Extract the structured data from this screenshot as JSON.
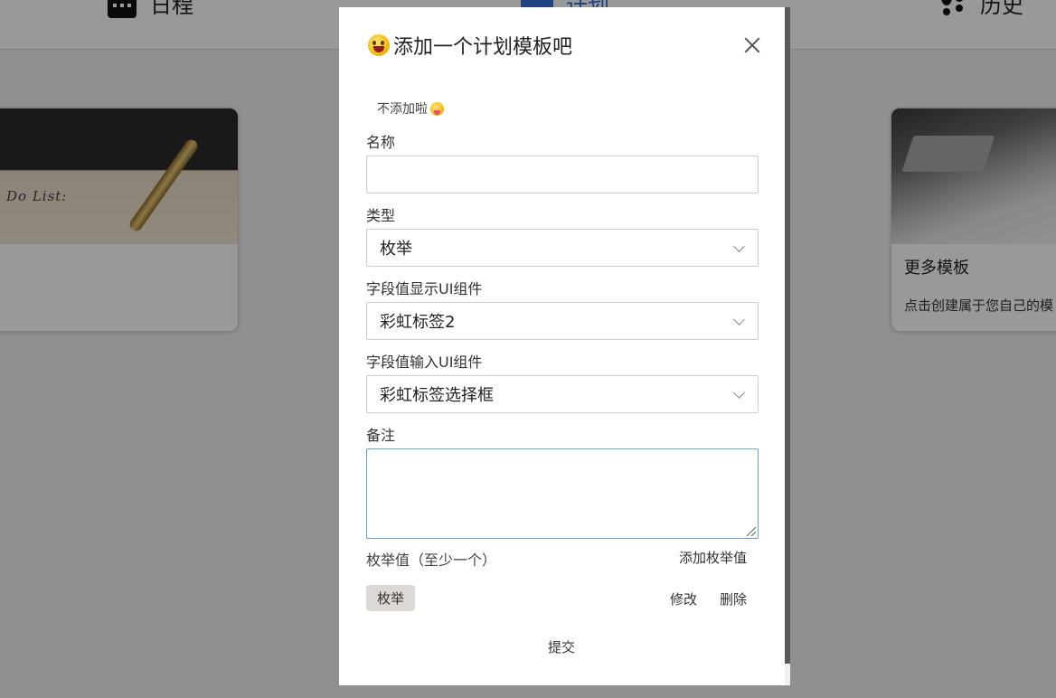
{
  "nav": {
    "schedule_label": "日程",
    "plan_label": "计划",
    "history_label": "历史"
  },
  "cards": {
    "left": {
      "photo_text": "Do List:"
    },
    "right": {
      "title": "更多模板",
      "desc": "点击创建属于您自己的模"
    }
  },
  "modal": {
    "title": "添加一个计划模板吧",
    "skip_label": "不添加啦",
    "fields": {
      "name_label": "名称",
      "name_value": "",
      "type_label": "类型",
      "type_value": "枚举",
      "display_label": "字段值显示UI组件",
      "display_value": "彩虹标签2",
      "input_label": "字段值输入UI组件",
      "input_value": "彩虹标签选择框",
      "note_label": "备注",
      "note_value": ""
    },
    "enum": {
      "label": "枚举值（至少一个）",
      "add_label": "添加枚举值",
      "items": [
        {
          "value": "枚举",
          "edit_label": "修改",
          "delete_label": "删除"
        }
      ]
    },
    "submit_label": "提交"
  }
}
